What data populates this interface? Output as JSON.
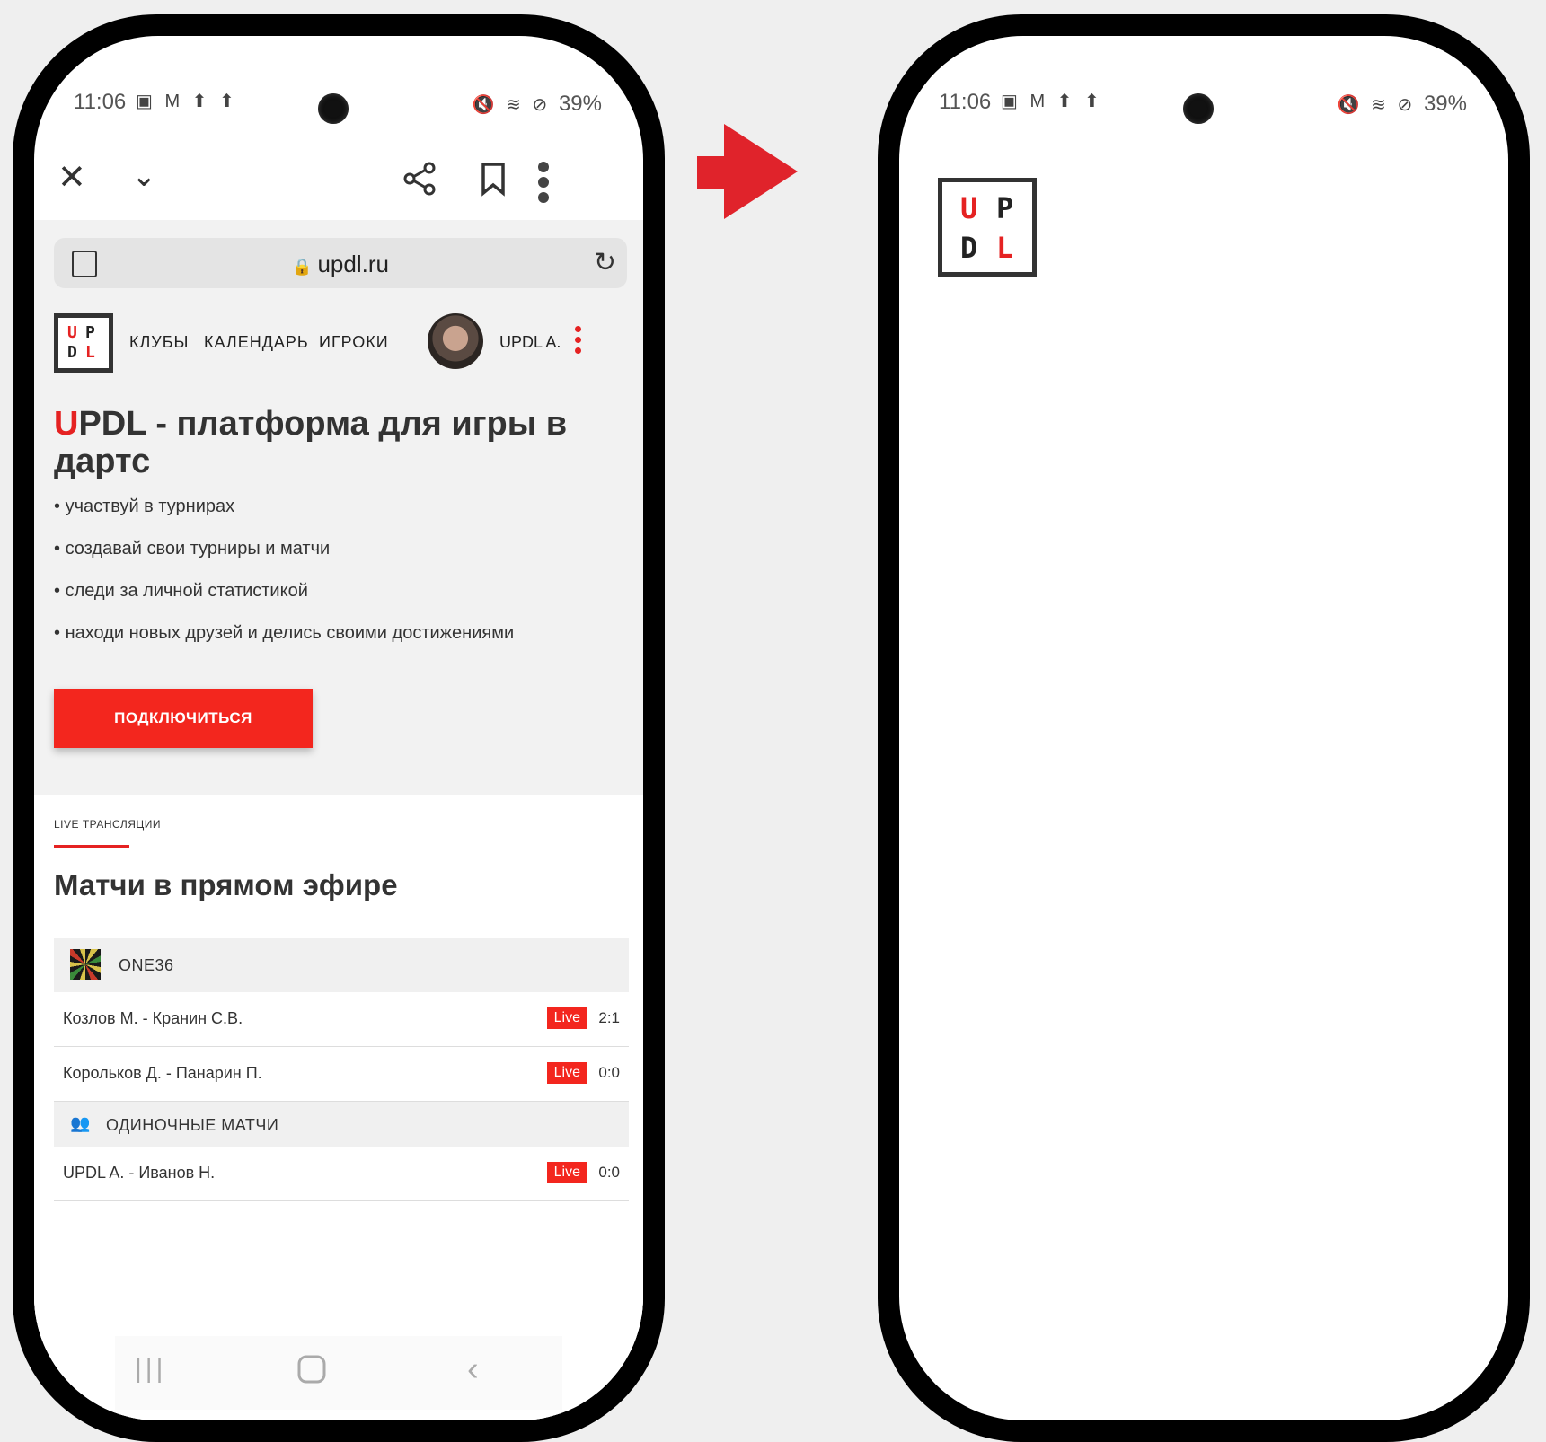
{
  "status_bar": {
    "time": "11:06",
    "left_icons": "▣ M ⬆ ⬆",
    "battery": "39%",
    "right_icons": "🔇 ⊘"
  },
  "browser": {
    "url": "updl.ru",
    "icons": {
      "close": "close-icon",
      "chevron": "chevron-down-icon",
      "share": "share-icon",
      "bookmark": "bookmark-icon",
      "menu": "more-vertical-icon",
      "tabs": "tabs-icon",
      "lock": "lock-icon",
      "reload": "reload-icon"
    }
  },
  "logo": {
    "letters": [
      "U",
      "P",
      "D",
      "L"
    ]
  },
  "nav": {
    "items": [
      "КЛУБЫ",
      "КАЛЕНДАРЬ",
      "ИГРОКИ"
    ],
    "user": "UPDL A."
  },
  "hero": {
    "title_accent": "U",
    "title_rest": "PDL - платформа для игры в дартс",
    "bullets": [
      "участвуй в турнирах",
      "создавай свои турниры и матчи",
      "следи за личной статистикой",
      "находи новых друзей и делись своими достижениями"
    ],
    "cta": "ПОДКЛЮЧИТЬСЯ"
  },
  "live": {
    "label": "LIVE ТРАНСЛЯЦИИ",
    "title": "Матчи в прямом эфире",
    "groups": [
      {
        "name": "ONE36",
        "matches": [
          {
            "players": "Козлов М. - Кранин С.В.",
            "badge": "Live",
            "score": "2:1"
          },
          {
            "players": "Корольков Д. - Панарин П.",
            "badge": "Live",
            "score": "0:0"
          }
        ]
      },
      {
        "name": "ОДИНОЧНЫЕ МАТЧИ",
        "matches": [
          {
            "players": "UPDL A. - Иванов Н.",
            "badge": "Live",
            "score": "0:0"
          }
        ]
      }
    ]
  },
  "colors": {
    "accent": "#e52222",
    "cta": "#f3261e",
    "arrow": "#e0232b",
    "page_bg": "#efefef"
  }
}
